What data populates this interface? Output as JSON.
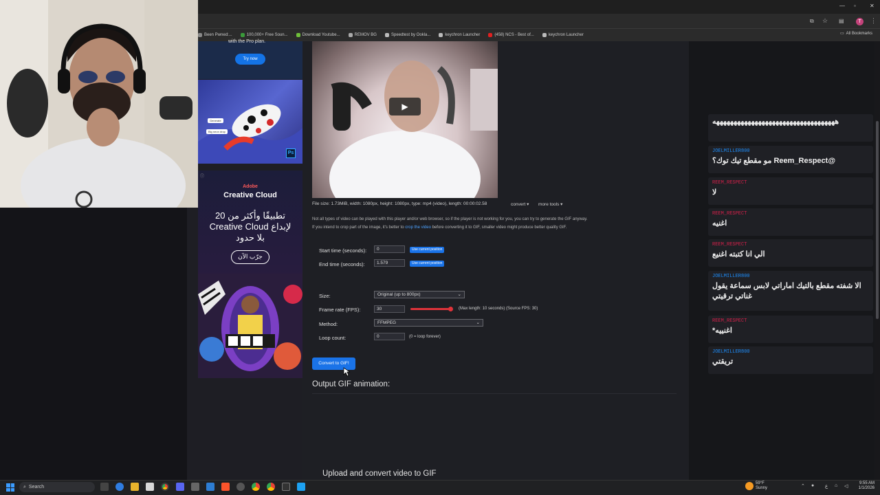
{
  "browser": {
    "bookmarks": [
      {
        "label": "Been Pwned:...",
        "color": "#888888"
      },
      {
        "label": "100,000+ Free Soun...",
        "color": "#3a9a3a"
      },
      {
        "label": "Download Youtube...",
        "color": "#6fbf3a"
      },
      {
        "label": "REMOV BG",
        "color": "#aaaaaa"
      },
      {
        "label": "Speedtest by Ookla...",
        "color": "#bbbbbb"
      },
      {
        "label": "keychron Launcher",
        "color": "#bbbbbb"
      },
      {
        "label": "(458) NCS - Best of...",
        "color": "#e02020"
      },
      {
        "label": "keychron Launcher",
        "color": "#bbbbbb"
      }
    ],
    "all_bookmarks": "All Bookmarks",
    "profile_initial": "T"
  },
  "ads": {
    "top_text": "with the Pro plan.",
    "try_now": "Try now",
    "frog_badge_1": "Generate",
    "frog_badge_2": "Big neon drop",
    "ps_logo": "Ps",
    "adobe": "Adobe",
    "creative_cloud": "Creative Cloud",
    "cc_arabic_line1": "20 تطبيقًا وأكثر من",
    "cc_arabic_line2": "Creative Cloud لإبداع",
    "cc_arabic_line3": "بلا حدود",
    "cc_button": "جرّب الآن"
  },
  "page": {
    "file_info": "File size: 1.73MiB, width: 1080px, height: 1080px, type: mp4 (video), length: 00:00:02.58",
    "convert_menu": "convert ▾",
    "more_tools": "more tools ▾",
    "note_line1": "Not all types of video can be played with this player and/or web browser, so if the player is not working for you, you can try to generate the GIF anyway.",
    "note_line2_before": "If you intend to crop part of the image, it's better to",
    "note_link": "crop the video",
    "note_line2_after": "before converting it to GIF, smaller video might produce better quality GIF.",
    "start_label": "Start time (seconds):",
    "start_value": "0",
    "end_label": "End time (seconds):",
    "end_value": "1.579",
    "use_current": "Use current position",
    "size_label": "Size:",
    "size_value": "Original (up to 800px)",
    "fps_label": "Frame rate (FPS):",
    "fps_value": "30",
    "fps_slider_level": 0.95,
    "fps_note": "(Max length: 10 seconds) (Source FPS: 30)",
    "method_label": "Method:",
    "method_value": "FFMPEG",
    "loop_label": "Loop count:",
    "loop_value": "0",
    "loop_note": "(0 = loop forever)",
    "convert_button": "Convert to GIF!",
    "output_heading": "Output GIF animation:",
    "upload_heading": "Upload and convert video to GIF"
  },
  "chat": [
    {
      "user": "",
      "user_color": "#ffffff",
      "message": "هههههههههههههههههههههههههههههههههههه"
    },
    {
      "user": "JOELMILLER800",
      "user_color": "#1e90ff",
      "message": "@Reem_Respect مو مقطع تيك توك؟"
    },
    {
      "user": "REEM_RESPECT",
      "user_color": "#d4204a",
      "message": "لا"
    },
    {
      "user": "REEM_RESPECT",
      "user_color": "#d4204a",
      "message": "اغنيه"
    },
    {
      "user": "REEM_RESPECT",
      "user_color": "#d4204a",
      "message": "الي انا كتبته اغنيع"
    },
    {
      "user": "JOELMILLER800",
      "user_color": "#1e90ff",
      "message": "الا شفته مقطع بالتيك اماراتي لابس سماعة يقول غناتي ترقيتي"
    },
    {
      "user": "REEM_RESPECT",
      "user_color": "#d4204a",
      "message": "اغنييه*"
    },
    {
      "user": "JOELMILLER800",
      "user_color": "#1e90ff",
      "message": "تريقتي"
    }
  ],
  "taskbar": {
    "search": "Search",
    "weather_temp": "59°F",
    "weather_desc": "Sunny",
    "time": "9:55 AM",
    "date": "1/1/2026",
    "lang": "ع"
  }
}
